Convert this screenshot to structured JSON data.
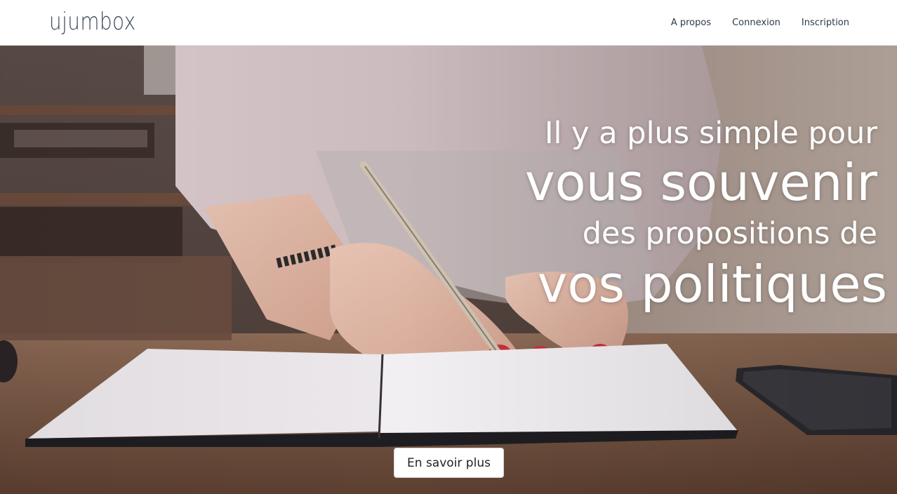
{
  "header": {
    "logo": "ujumbox",
    "nav": [
      {
        "label": "A propos"
      },
      {
        "label": "Connexion"
      },
      {
        "label": "Inscription"
      }
    ]
  },
  "hero": {
    "line1": "Il y a plus simple pour",
    "line2": "vous souvenir",
    "line3": "des propositions de",
    "line4": "vos politiques",
    "cta": "En savoir plus",
    "background_image": "woman-writing-in-notebook-photo"
  },
  "colors": {
    "logo": "#3d4a5a",
    "nav_text": "#2b3a4a",
    "headline": "#ffffff",
    "button_bg": "#ffffff"
  }
}
